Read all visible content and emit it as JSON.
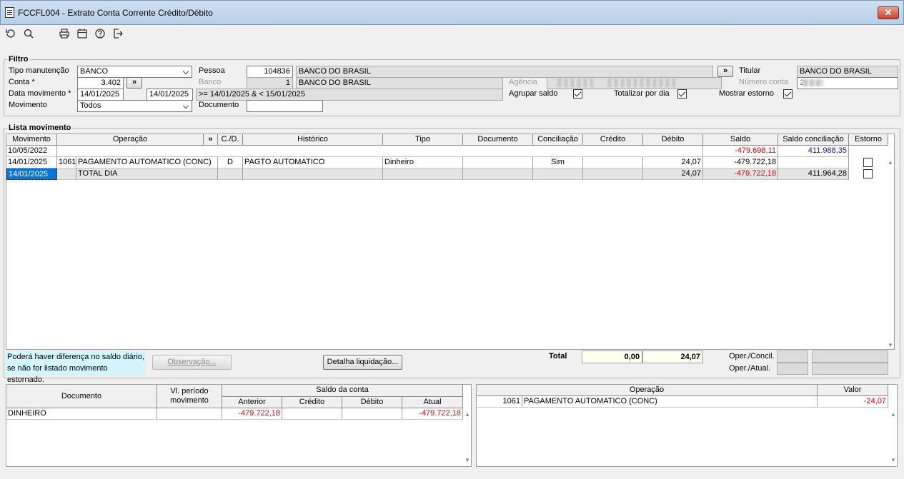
{
  "window": {
    "title": "FCCFL004 - Extrato Conta Corrente Crédito/Débito",
    "close": "✕"
  },
  "toolbar": {
    "icons": [
      "refresh-icon",
      "search-icon",
      "print-icon",
      "calendar-icon",
      "help-icon",
      "exit-icon"
    ]
  },
  "filtro": {
    "legend": "Filtro",
    "tipo_manutencao_label": "Tipo manutenção",
    "tipo_manutencao_value": "BANCO",
    "conta_label": "Conta *",
    "conta_value": "3.402",
    "conta_btn": "»",
    "data_movimento_label": "Data movimento *",
    "data_de": "14/01/2025",
    "data_ate": "14/01/2025",
    "data_expr": ">= 14/01/2025 & < 15/01/2025",
    "movimento_label": "Movimento",
    "movimento_value": "Todos",
    "pessoa_label": "Pessoa",
    "pessoa_code": "104836",
    "pessoa_name": "BANCO DO BRASIL",
    "pessoa_btn": "»",
    "banco_label": "Banco",
    "banco_code": "1",
    "banco_name": "BANCO DO BRASIL",
    "agencia_label": "Agência",
    "documento_label": "Documento",
    "documento_value": "",
    "titular_label": "Titular",
    "titular_value": "BANCO DO BRASIL",
    "numero_conta_label": "Número conta",
    "numero_conta_value": "2",
    "agrupar_saldo_label": "Agrupar saldo",
    "totalizar_label": "Totalizar por dia",
    "mostrar_estorno_label": "Mostrar estorno"
  },
  "lista": {
    "legend": "Lista movimento",
    "headers": [
      "Movimento",
      "Operação",
      "»",
      "C./D.",
      "Histórico",
      "Tipo",
      "Documento",
      "Conciliação",
      "Crédito",
      "Débito",
      "Saldo",
      "Saldo conciliação",
      "Estorno"
    ],
    "rows": [
      {
        "movimento": "10/05/2022",
        "op_code": "",
        "operacao": "",
        "cd": "",
        "historico": "",
        "tipo": "",
        "documento": "",
        "conciliacao": "",
        "credito": "",
        "debito": "",
        "saldo": "-479.698,11",
        "saldo_conc": "411.988,35"
      },
      {
        "movimento": "14/01/2025",
        "op_code": "1061",
        "operacao": "PAGAMENTO AUTOMATICO (CONC)",
        "cd": "D",
        "historico": "PAGTO AUTOMATICO",
        "tipo": "Dinheiro",
        "documento": "",
        "conciliacao": "Sim",
        "credito": "",
        "debito": "24,07",
        "saldo": "-479.722,18",
        "saldo_conc": ""
      },
      {
        "movimento": "14/01/2025",
        "op_code": "",
        "operacao": "TOTAL DIA",
        "cd": "",
        "historico": "",
        "tipo": "",
        "documento": "",
        "conciliacao": "",
        "credito": "",
        "debito": "24,07",
        "saldo": "-479.722,18",
        "saldo_conc": "411.964,28"
      }
    ],
    "note_line1": "Poderá haver diferença no saldo diário,",
    "note_line2": "se não for listado movimento estornado.",
    "observacao_btn": "Observação...",
    "detalha_btn": "Detalha liquidação...",
    "total_label": "Total",
    "total_credito": "0,00",
    "total_debito": "24,07",
    "oper_concil_label": "Oper./Concil.",
    "oper_atual_label": "Oper./Atual."
  },
  "docs": {
    "headers": {
      "documento": "Documento",
      "vl_periodo": "Vl. período movimento",
      "saldo_conta": "Saldo da conta",
      "anterior": "Anterior",
      "credito": "Crédito",
      "debito": "Débito",
      "atual": "Atual"
    },
    "rows": [
      {
        "documento": "DINHEIRO",
        "vl_periodo": "",
        "anterior": "-479.722,18",
        "credito": "",
        "debito": "",
        "atual": "-479.722,18"
      }
    ]
  },
  "ops": {
    "headers": {
      "operacao": "Operação",
      "valor": "Valor"
    },
    "rows": [
      {
        "code": "1061",
        "operacao": "PAGAMENTO AUTOMATICO (CONC)",
        "valor": "-24,07"
      }
    ]
  }
}
